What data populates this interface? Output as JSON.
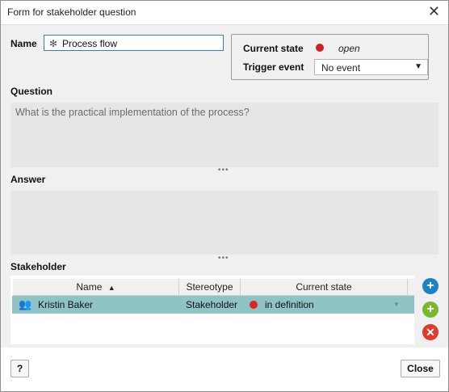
{
  "window": {
    "title": "Form for stakeholder question"
  },
  "name": {
    "label": "Name",
    "required_marker": "✻",
    "value": "Process flow"
  },
  "state_panel": {
    "current_state_label": "Current state",
    "current_state_value": "open",
    "state_color": "#cc2222",
    "trigger_event_label": "Trigger event",
    "trigger_event_value": "No event"
  },
  "question": {
    "label": "Question",
    "value": "What is the practical implementation of the process?"
  },
  "answer": {
    "label": "Answer",
    "value": ""
  },
  "stakeholder": {
    "label": "Stakeholder",
    "columns": {
      "name": "Name",
      "sort_indicator": "▲",
      "stereotype": "Stereotype",
      "current_state": "Current state"
    },
    "rows": [
      {
        "name": "Kristin Baker",
        "stereotype": "Stakeholder",
        "state": "in definition",
        "state_color": "#e02424",
        "icon": "group-icon"
      }
    ],
    "actions": {
      "add_icon": "add-icon",
      "new_icon": "new-icon",
      "remove_icon": "remove-icon"
    }
  },
  "footer": {
    "help_label": "?",
    "close_label": "Close"
  }
}
